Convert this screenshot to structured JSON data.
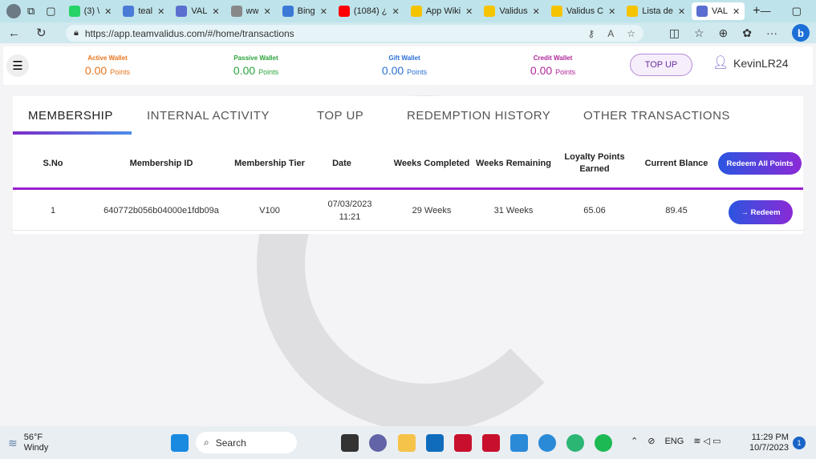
{
  "browser": {
    "tabs": [
      {
        "label": "(3) \\",
        "color": "#25d366"
      },
      {
        "label": "teal",
        "color": "#4a7bd6"
      },
      {
        "label": "VAL",
        "color": "#5a6fd0"
      },
      {
        "label": "ww",
        "color": "#888888"
      },
      {
        "label": "Bing",
        "color": "#3a7ad6"
      },
      {
        "label": "(1084) ¿",
        "color": "#ff0000"
      },
      {
        "label": "App Wiki",
        "color": "#f5c400"
      },
      {
        "label": "Validus",
        "color": "#f5c400"
      },
      {
        "label": "Validus C",
        "color": "#f5c400"
      },
      {
        "label": "Lista de",
        "color": "#f5c400"
      },
      {
        "label": "VAL",
        "color": "#5a6fd0"
      }
    ],
    "url": "https://app.teamvalidus.com/#/home/transactions"
  },
  "header": {
    "wallets": [
      {
        "label": "Active Wallet",
        "value": "0.00",
        "unit": "Points",
        "color": "#e8741c"
      },
      {
        "label": "Passive Wallet",
        "value": "0.00",
        "unit": "Points",
        "color": "#2aa43a"
      },
      {
        "label": "Gift Wallet",
        "value": "0.00",
        "unit": "Points",
        "color": "#2a6fd6"
      },
      {
        "label": "Credit Wallet",
        "value": "0.00",
        "unit": "Points",
        "color": "#b0279a"
      }
    ],
    "topup_label": "TOP UP",
    "username": "KevinLR24"
  },
  "tabs": [
    "MEMBERSHIP",
    "INTERNAL ACTIVITY",
    "TOP UP",
    "REDEMPTION HISTORY",
    "OTHER TRANSACTIONS"
  ],
  "table": {
    "headers": [
      "S.No",
      "Membership ID",
      "Membership Tier",
      "Date",
      "Weeks Completed",
      "Weeks Remaining",
      "Loyalty Points Earned",
      "Current Blance"
    ],
    "redeem_all_label": "Redeem All Points",
    "rows": [
      {
        "sno": "1",
        "id": "640772b056b04000e1fdb09a",
        "tier": "V100",
        "date": "07/03/2023",
        "time": "11:21",
        "completed": "29 Weeks",
        "remaining": "31 Weeks",
        "loyalty": "65.06",
        "balance": "89.45",
        "redeem": "→ Redeem"
      }
    ]
  },
  "taskbar": {
    "temp": "56°F",
    "weather": "Windy",
    "search": "Search",
    "lang": "ENG",
    "time": "11:29 PM",
    "date": "10/7/2023",
    "notif": "1"
  }
}
